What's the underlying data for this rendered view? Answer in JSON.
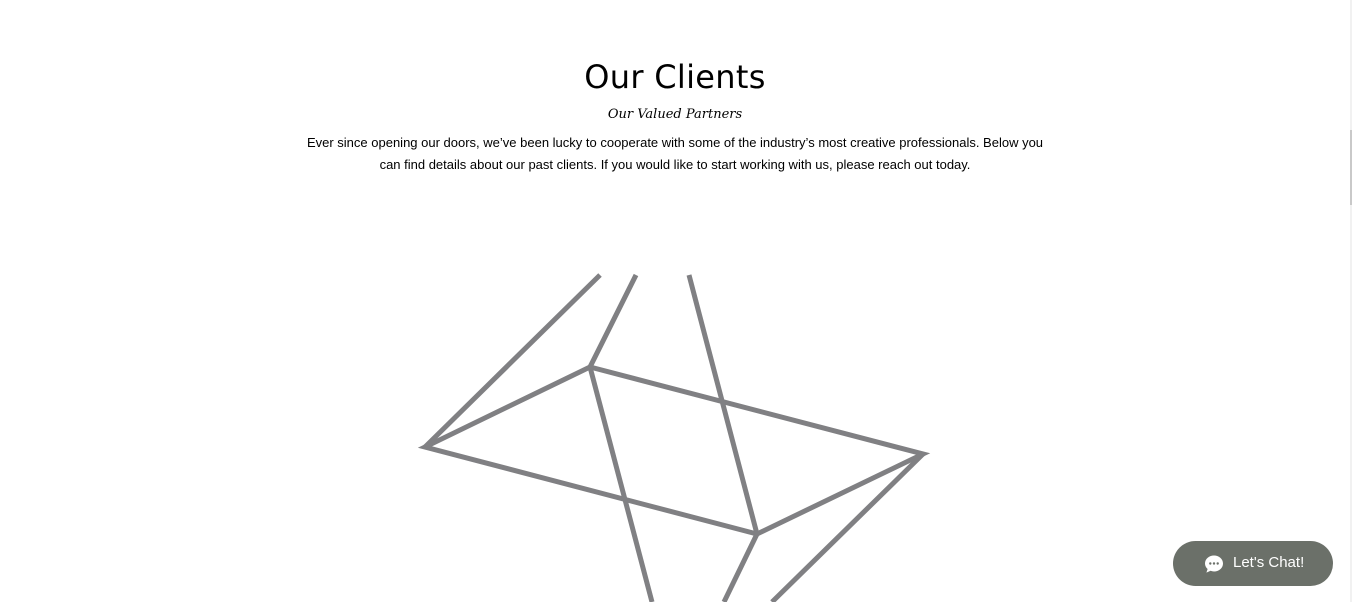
{
  "section": {
    "title": "Our Clients",
    "subtitle": "Our Valued Partners",
    "intro": "Ever since opening our doors, we’ve been lucky to cooperate with some of the industry’s most creative professionals. Below you can find details about our past clients. If you would like to start working with us, please reach out today."
  },
  "chat": {
    "label": "Let's Chat!",
    "icon": "chat-bubble-icon",
    "color": "#6b7069"
  },
  "artwork": {
    "icon": "geometric-line-art",
    "stroke_color": "#808083"
  }
}
